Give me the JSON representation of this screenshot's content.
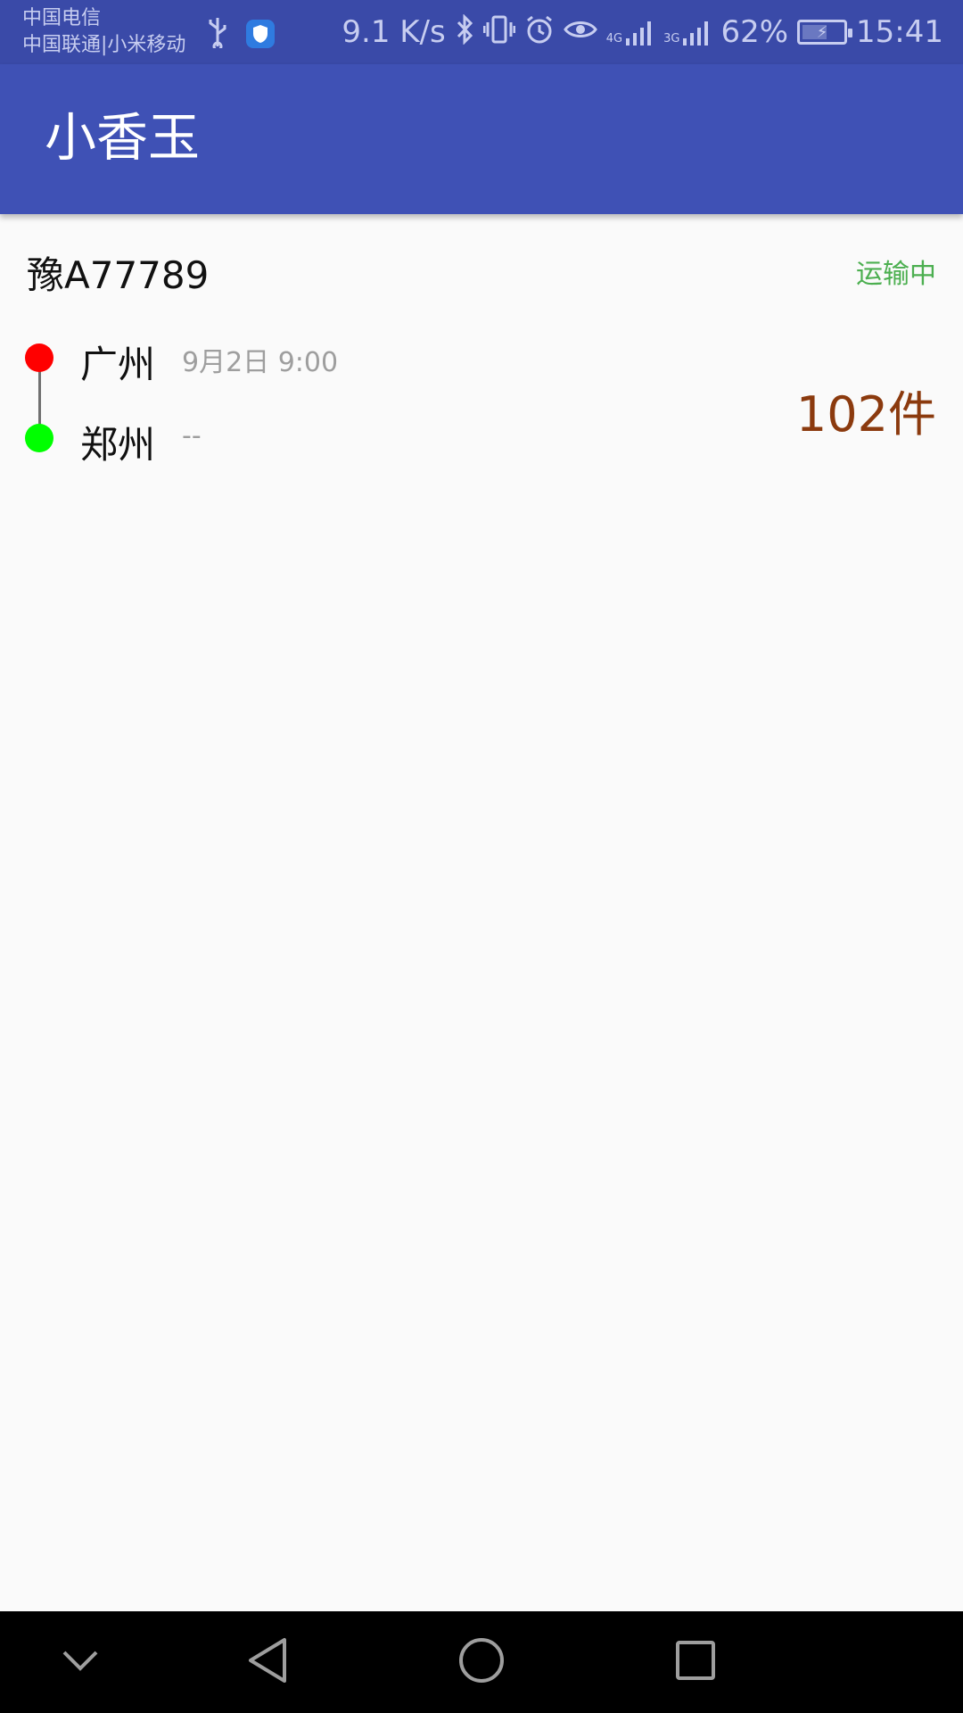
{
  "status_bar": {
    "carrier_1": "中国电信",
    "carrier_2": "中国联通|小米移动",
    "net_speed": "9.1 K/s",
    "signal_4g": "4G",
    "signal_3g": "3G",
    "battery": "62%",
    "battery_level": 0.62,
    "time": "15:41"
  },
  "app_bar": {
    "title": "小香玉"
  },
  "shipment": {
    "plate": "豫A77789",
    "status": "运输中",
    "origin": {
      "city": "广州",
      "time": "9月2日 9:00"
    },
    "destination": {
      "city": "郑州",
      "time": "--"
    },
    "quantity": "102件"
  },
  "colors": {
    "primary": "#3f51b5",
    "status_green": "#4caf50",
    "origin_dot": "#ff0000",
    "destination_dot": "#00ff00",
    "quantity": "#8b3a0e"
  },
  "icons": [
    "usb-icon",
    "shield-icon",
    "bluetooth-icon",
    "vibrate-icon",
    "alarm-icon",
    "eye-icon",
    "signal-icon",
    "battery-icon",
    "nav-down-icon",
    "nav-back-icon",
    "nav-home-icon",
    "nav-recents-icon"
  ]
}
